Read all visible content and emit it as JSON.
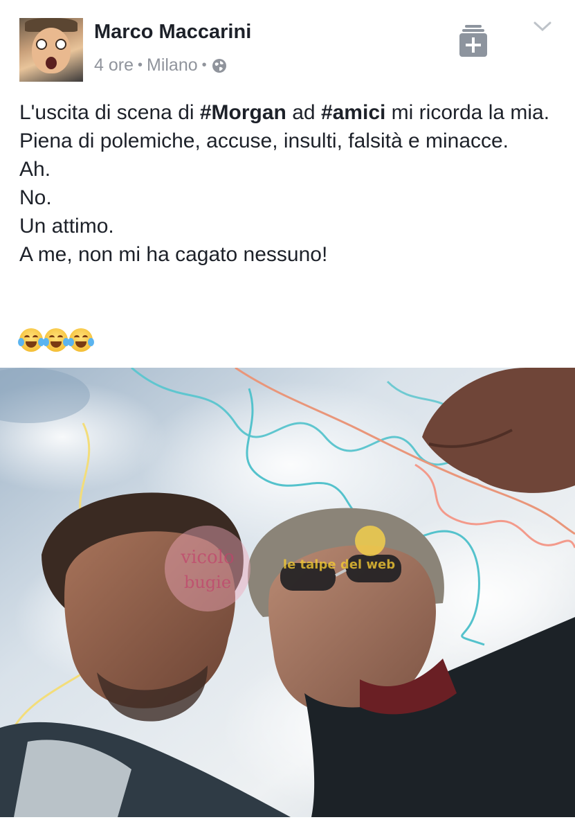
{
  "post": {
    "author": "Marco Maccarini",
    "time": "4 ore",
    "separator": "•",
    "location": "Milano",
    "privacy_icon": "globe-icon",
    "save_icon": "save-to-collection-icon",
    "menu_icon": "chevron-down-icon",
    "text": {
      "line1_a": "L'uscita di scena di ",
      "line1_tag1": "#Morgan",
      "line1_b": " ad ",
      "line1_tag2": "#amici",
      "line1_c": " mi ricorda la mia.",
      "line2": "Piena di polemiche, accuse, insulti, falsità e minacce.",
      "line3": "Ah.",
      "line4": "No.",
      "line5": "Un attimo.",
      "line6": "A me, non mi ha cagato nessuno!"
    },
    "emojis": [
      "face-with-tears-of-joy",
      "face-with-tears-of-joy",
      "face-with-tears-of-joy"
    ]
  },
  "photo": {
    "description_icon": "selfie-photo",
    "watermark1": "vicolo delle bugie",
    "watermark2": "le talpe del web"
  },
  "colors": {
    "text": "#1d2129",
    "meta": "#90949c",
    "icon_gray": "#8d949e",
    "sky": "#cdd8e2"
  }
}
